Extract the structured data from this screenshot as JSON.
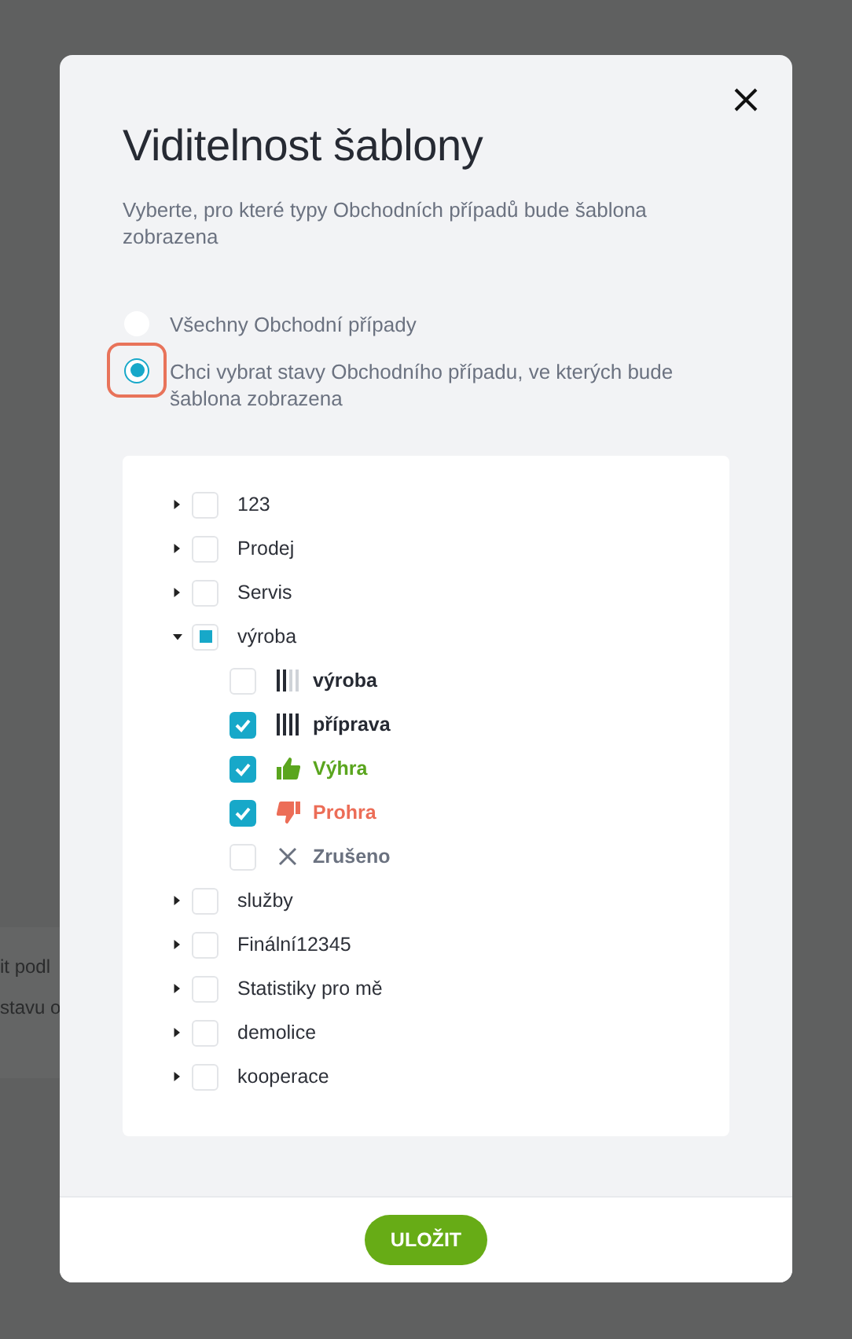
{
  "background": {
    "texts": [
      "it podl",
      "stavu o"
    ]
  },
  "dialog": {
    "title": "Viditelnost šablony",
    "description": "Vyberte, pro které typy Obchodních případů bude šablona zobrazena",
    "options": [
      {
        "label": "Všechny Obchodní případy",
        "selected": false
      },
      {
        "label": "Chci vybrat stavy Obchodního případu, ve kterých bude šablona zobrazena",
        "selected": true
      }
    ],
    "tree": [
      {
        "label": "123",
        "expanded": false,
        "checked": false,
        "partial": false
      },
      {
        "label": "Prodej",
        "expanded": false,
        "checked": false,
        "partial": false
      },
      {
        "label": "Servis",
        "expanded": false,
        "checked": false,
        "partial": false
      },
      {
        "label": "výroba",
        "expanded": true,
        "checked": false,
        "partial": true,
        "children": [
          {
            "label": "výroba",
            "kind": "stage",
            "level": 0.5,
            "checked": false
          },
          {
            "label": "příprava",
            "kind": "stage",
            "level": 1,
            "checked": true
          },
          {
            "label": "Výhra",
            "kind": "win",
            "checked": true
          },
          {
            "label": "Prohra",
            "kind": "loss",
            "checked": true
          },
          {
            "label": "Zrušeno",
            "kind": "cancelled",
            "checked": false
          }
        ]
      },
      {
        "label": "služby",
        "expanded": false,
        "checked": false,
        "partial": false
      },
      {
        "label": "Finální12345",
        "expanded": false,
        "checked": false,
        "partial": false
      },
      {
        "label": "Statistiky pro mě",
        "expanded": false,
        "checked": false,
        "partial": false
      },
      {
        "label": "demolice",
        "expanded": false,
        "checked": false,
        "partial": false
      },
      {
        "label": "kooperace",
        "expanded": false,
        "checked": false,
        "partial": false
      }
    ],
    "save_button": "ULOŽIT"
  }
}
